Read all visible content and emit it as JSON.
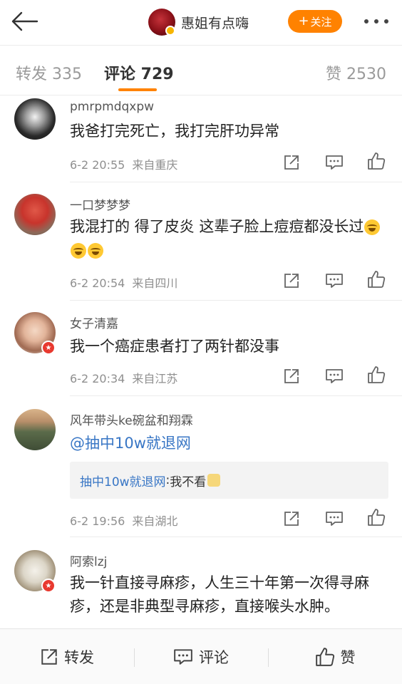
{
  "header": {
    "author_name": "惠姐有点嗨",
    "follow_label": "关注",
    "follow_plus": "+"
  },
  "tabs": {
    "forward": "转发 335",
    "comments": "评论 729",
    "likes": "赞 2530"
  },
  "comments": [
    {
      "username": "pmrpmdqxpw",
      "text": "我爸打完死亡，我打完肝功异常",
      "date": "6-2 20:55",
      "location": "来自重庆"
    },
    {
      "username": "一口梦梦梦",
      "text": "我混打的 得了皮炎 这辈子脸上痘痘都没长过",
      "emojis": [
        "laugh-cry-emoji",
        "laugh-cry-emoji",
        "laugh-cry-emoji"
      ],
      "date": "6-2 20:54",
      "location": "来自四川"
    },
    {
      "username": "女子清嘉",
      "text": "我一个癌症患者打了两针都没事",
      "date": "6-2 20:34",
      "location": "来自江苏"
    },
    {
      "username": "风年带头ke碗盆和翔霖",
      "text": "@抽中10w就退网",
      "reply": {
        "user": "抽中10w就退网",
        "separator": ": ",
        "text": "我不看"
      },
      "date": "6-2 19:56",
      "location": "来自湖北"
    },
    {
      "username": "阿索lzj",
      "text": "我一针直接寻麻疹，人生三十年第一次得寻麻疹，还是非典型寻麻疹，直接喉头水肿。"
    }
  ],
  "bottom_bar": {
    "forward": "转发",
    "comment": "评论",
    "like": "赞"
  },
  "colors": {
    "accent": "#ff8200",
    "link": "#3876c5",
    "muted": "#8f8f8f"
  }
}
